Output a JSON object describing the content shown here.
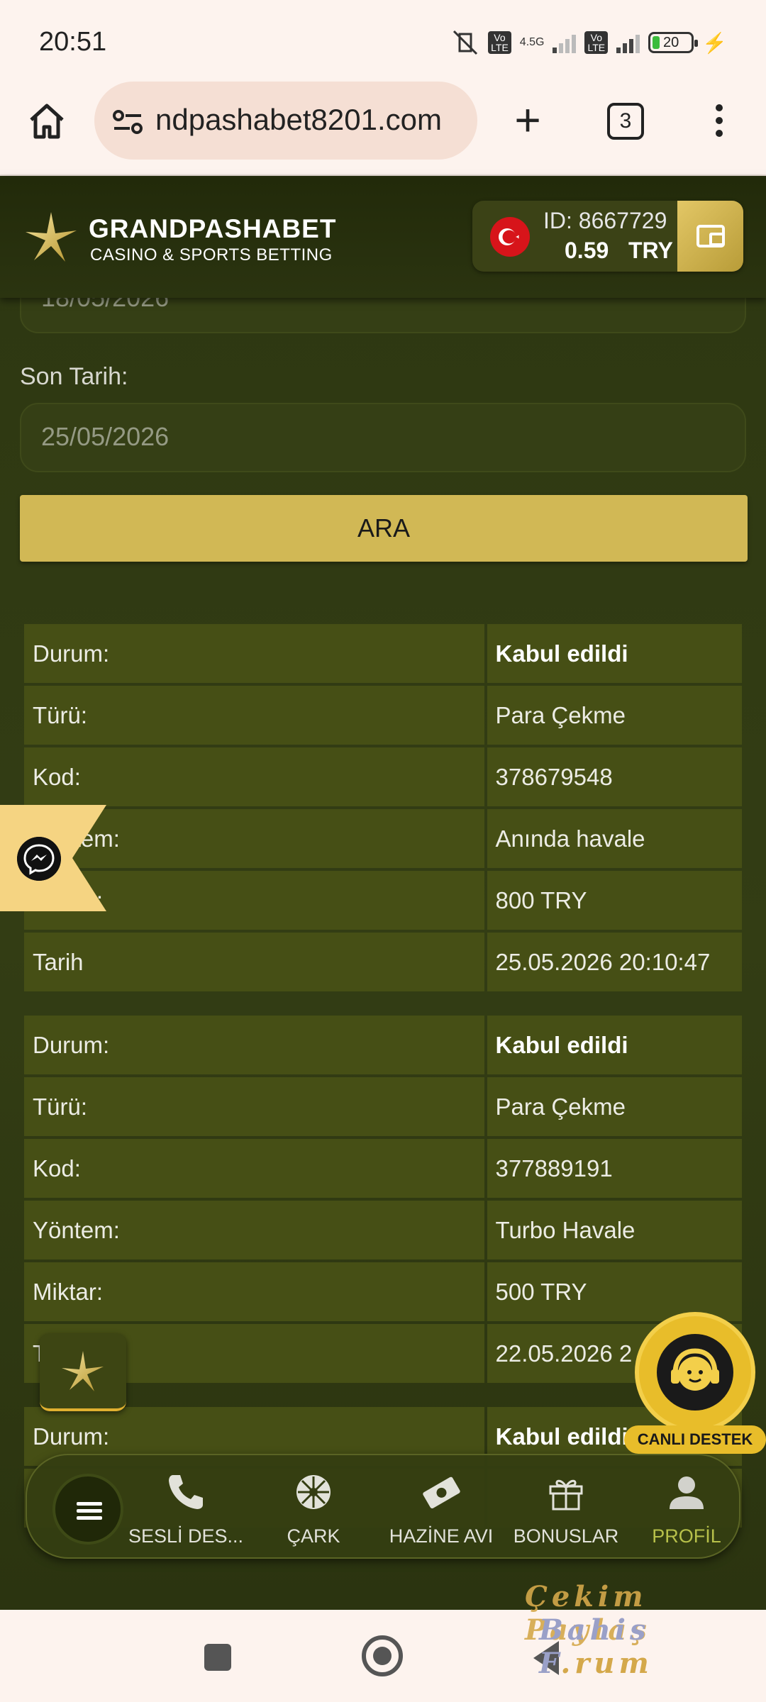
{
  "status_bar": {
    "time": "20:51",
    "network_type": "4.5G",
    "lte_label": "Vo LTE",
    "battery": "20"
  },
  "browser": {
    "url": "ndpashabet8201.com",
    "tab_count": "3"
  },
  "header": {
    "brand": "GRANDPASHABET",
    "tagline": "CASINO & SPORTS BETTING",
    "account_id": "ID: 8667729",
    "balance": "0.59",
    "currency": "TRY"
  },
  "filter": {
    "start_date_value": "18/05/2026",
    "end_date_label": "Son Tarih:",
    "end_date_value": "25/05/2026",
    "search_label": "ARA"
  },
  "transactions": [
    {
      "rows": [
        {
          "key": "Durum:",
          "value": "Kabul edildi"
        },
        {
          "key": "Türü:",
          "value": "Para Çekme"
        },
        {
          "key": "Kod:",
          "value": "378679548"
        },
        {
          "key": "Yöntem:",
          "value": "Anında havale"
        },
        {
          "key": "Miktar:",
          "value": "800 TRY"
        },
        {
          "key": "Tarih",
          "value": "25.05.2026 20:10:47"
        }
      ]
    },
    {
      "rows": [
        {
          "key": "Durum:",
          "value": "Kabul edildi"
        },
        {
          "key": "Türü:",
          "value": "Para Çekme"
        },
        {
          "key": "Kod:",
          "value": "377889191"
        },
        {
          "key": "Yöntem:",
          "value": "Turbo Havale"
        },
        {
          "key": "Miktar:",
          "value": "500 TRY"
        },
        {
          "key": "Tarih",
          "value": "22.05.2026 2"
        }
      ]
    },
    {
      "rows": [
        {
          "key": "Durum:",
          "value": "Kabul edildi"
        }
      ]
    }
  ],
  "live_support": {
    "label": "CANLI DESTEK"
  },
  "bottom_nav": {
    "items": [
      {
        "label": "SESLİ DES...",
        "icon": "phone-icon"
      },
      {
        "label": "ÇARK",
        "icon": "wheel-icon"
      },
      {
        "label": "HAZİNE AVI",
        "icon": "money-icon"
      },
      {
        "label": "BONUSLAR",
        "icon": "gift-icon"
      },
      {
        "label": "PROFİL",
        "icon": "user-icon"
      }
    ]
  },
  "watermark": {
    "line1": "Çekim Paylaş",
    "line2a": "Bahis F",
    "line2b": ".rum"
  },
  "colors": {
    "accent_gold": "#d1b855",
    "row_bg": "#464f15",
    "page_bg": "#2e3812",
    "active_nav": "#b7c04a"
  }
}
